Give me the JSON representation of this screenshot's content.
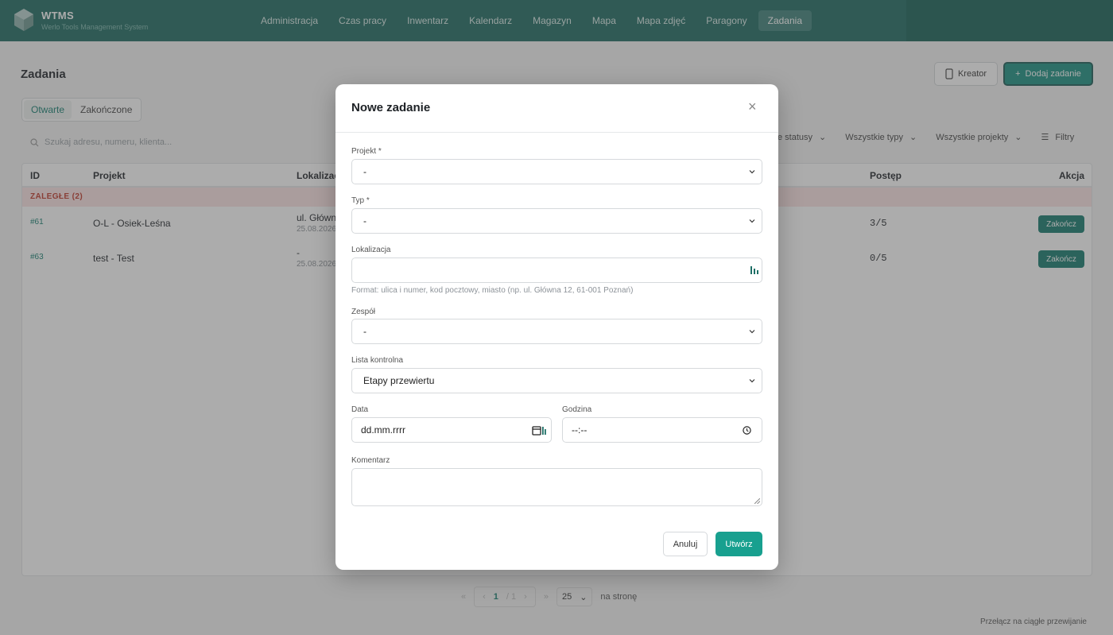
{
  "app": {
    "title": "WTMS",
    "subtitle": "Werlo Tools Management System"
  },
  "nav": [
    "Administracja",
    "Czas pracy",
    "Inwentarz",
    "Kalendarz",
    "Magazyn",
    "Mapa",
    "Mapa zdjęć",
    "Paragony",
    "Zadania"
  ],
  "page": {
    "title": "Zadania",
    "kreator_label": "Kreator",
    "add_label": "Dodaj zadanie",
    "tabs": [
      "Otwarte",
      "Zakończone"
    ],
    "search_placeholder": "Szukaj adresu, numeru, klienta...",
    "filters": [
      "e statusy",
      "Wszystkie typy",
      "Wszystkie projekty",
      "Filtry"
    ]
  },
  "table": {
    "headers": {
      "id": "ID",
      "projekt": "Projekt",
      "lokalizacja": "Lokalizac",
      "postep": "Postęp",
      "akcja": "Akcja"
    },
    "group_label": "ZALEGŁE (2)",
    "rows": [
      {
        "id": "#61",
        "projekt": "O-L - Osiek-Leśna",
        "lok": "ul. Główn",
        "date": "25.08.2026",
        "postep": "3/5",
        "action": "Zakończ"
      },
      {
        "id": "#63",
        "projekt": "test - Test",
        "lok": "-",
        "date": "25.08.2026",
        "postep": "0/5",
        "action": "Zakończ"
      }
    ]
  },
  "pager": {
    "first": "«",
    "prev": "‹",
    "page": "1",
    "of": "/ 1",
    "next": "›",
    "last": "»",
    "per_page": "25",
    "per_page_label": "na stronę"
  },
  "footer_link": "Przełącz na ciągłe przewijanie",
  "modal": {
    "title": "Nowe zadanie",
    "close": "×",
    "projekt_label": "Projekt *",
    "projekt_value": "-",
    "typ_label": "Typ *",
    "typ_value": "-",
    "lokalizacja_label": "Lokalizacja",
    "lokalizacja_value": "",
    "lokalizacja_hint": "Format: ulica i numer, kod pocztowy, miasto (np. ul. Główna 12, 61-001 Poznań)",
    "zespol_label": "Zespół",
    "zespol_value": "-",
    "lista_label": "Lista kontrolna",
    "lista_value": "Etapy przewiertu",
    "data_label": "Data",
    "data_value": "dd.mm.rrrr",
    "godzina_label": "Godzina",
    "godzina_value": "--:--",
    "komentarz_label": "Komentarz",
    "cancel_label": "Anuluj",
    "create_label": "Utwórz"
  },
  "colors": {
    "topbar": "#1e6b61",
    "accent": "#18a08f",
    "overdue_bg": "#fbe3e3",
    "overdue_text": "#c0392b"
  }
}
